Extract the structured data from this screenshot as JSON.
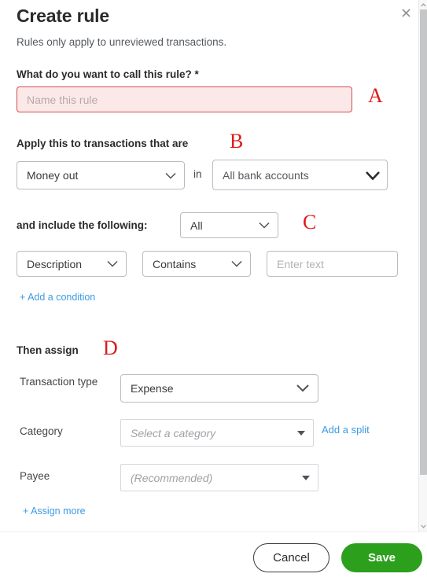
{
  "dialog": {
    "title": "Create rule",
    "subtitle": "Rules only apply to unreviewed transactions.",
    "close_icon": "close-icon"
  },
  "name_section": {
    "label": "What do you want to call this rule? *",
    "placeholder": "Name this rule",
    "value": "",
    "annotation": "A",
    "error_bg": "#fbe9e9",
    "error_border": "#d44c4c"
  },
  "apply_section": {
    "label": "Apply this to transactions that are",
    "annotation": "B",
    "direction_value": "Money out",
    "connector": "in",
    "account_value": "All bank accounts"
  },
  "include_section": {
    "label": "and include the following:",
    "match_value": "All",
    "annotation": "C",
    "condition": {
      "field_value": "Description",
      "operator_value": "Contains",
      "text_placeholder": "Enter text",
      "text_value": ""
    },
    "add_condition_link": "+ Add a condition"
  },
  "assign_section": {
    "heading": "Then assign",
    "annotation": "D",
    "rows": [
      {
        "label": "Transaction type",
        "value": "Expense",
        "placeholder": ""
      },
      {
        "label": "Category",
        "value": "",
        "placeholder": "Select a category"
      },
      {
        "label": "Payee",
        "value": "",
        "placeholder": "(Recommended)"
      }
    ],
    "add_split_link": "Add a split",
    "assign_more_link": "+ Assign more"
  },
  "footer": {
    "cancel_label": "Cancel",
    "save_label": "Save",
    "save_color": "#2ca01c"
  },
  "scrollbar": {
    "up_arrow": "chevron-up-icon",
    "down_arrow": "chevron-down-icon"
  }
}
